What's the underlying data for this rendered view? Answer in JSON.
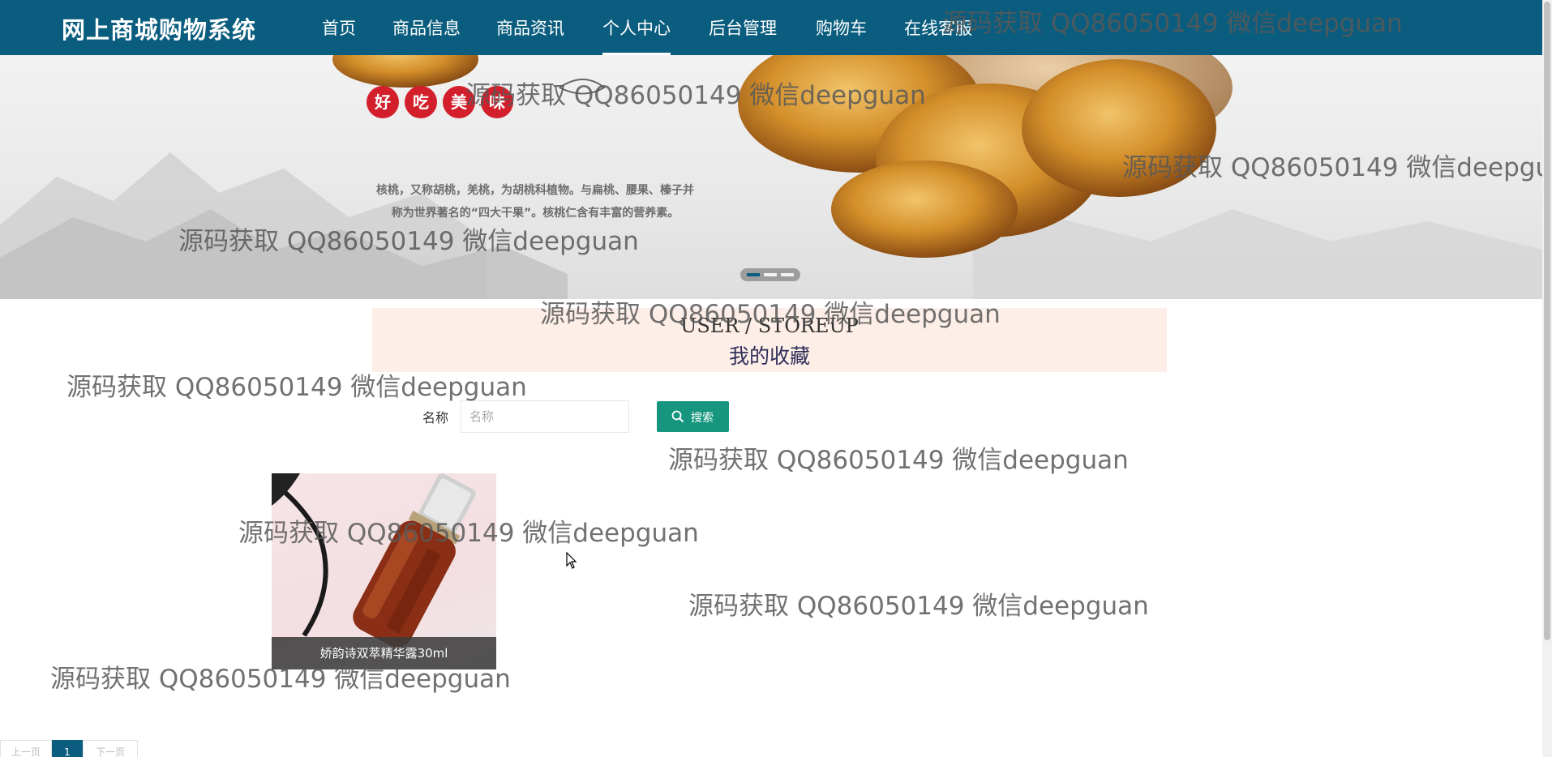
{
  "header": {
    "brand": "网上商城购物系统",
    "nav": [
      {
        "label": "首页"
      },
      {
        "label": "商品信息"
      },
      {
        "label": "商品资讯"
      },
      {
        "label": "个人中心",
        "active": true
      },
      {
        "label": "后台管理"
      },
      {
        "label": "购物车"
      },
      {
        "label": "在线客服"
      }
    ]
  },
  "banner": {
    "badges": [
      "好",
      "吃",
      "美",
      "味"
    ],
    "desc_line1": "核桃，又称胡桃，羌桃，为胡桃科植物。与扁桃、腰果、榛子并",
    "desc_line2": "称为世界著名的“四大干果”。核桃仁含有丰富的营养素。",
    "slide_count": 3,
    "active_slide": 1
  },
  "section": {
    "title_en": "USER / STOREUP",
    "title_cn": "我的收藏"
  },
  "search": {
    "label": "名称",
    "placeholder": "名称",
    "value": "",
    "button_label": "搜索"
  },
  "products": [
    {
      "name": "娇韵诗双萃精华露30ml"
    }
  ],
  "pagination": {
    "prev": "上一页",
    "current": "1",
    "next": "下一页"
  },
  "watermark": {
    "text": "源码获取 QQ86050149 微信deepguan"
  },
  "colors": {
    "nav_bg": "#0a5d7e",
    "search_button": "#16967e",
    "section_bg": "#fdeee7",
    "badge_red": "#d21f2b"
  }
}
